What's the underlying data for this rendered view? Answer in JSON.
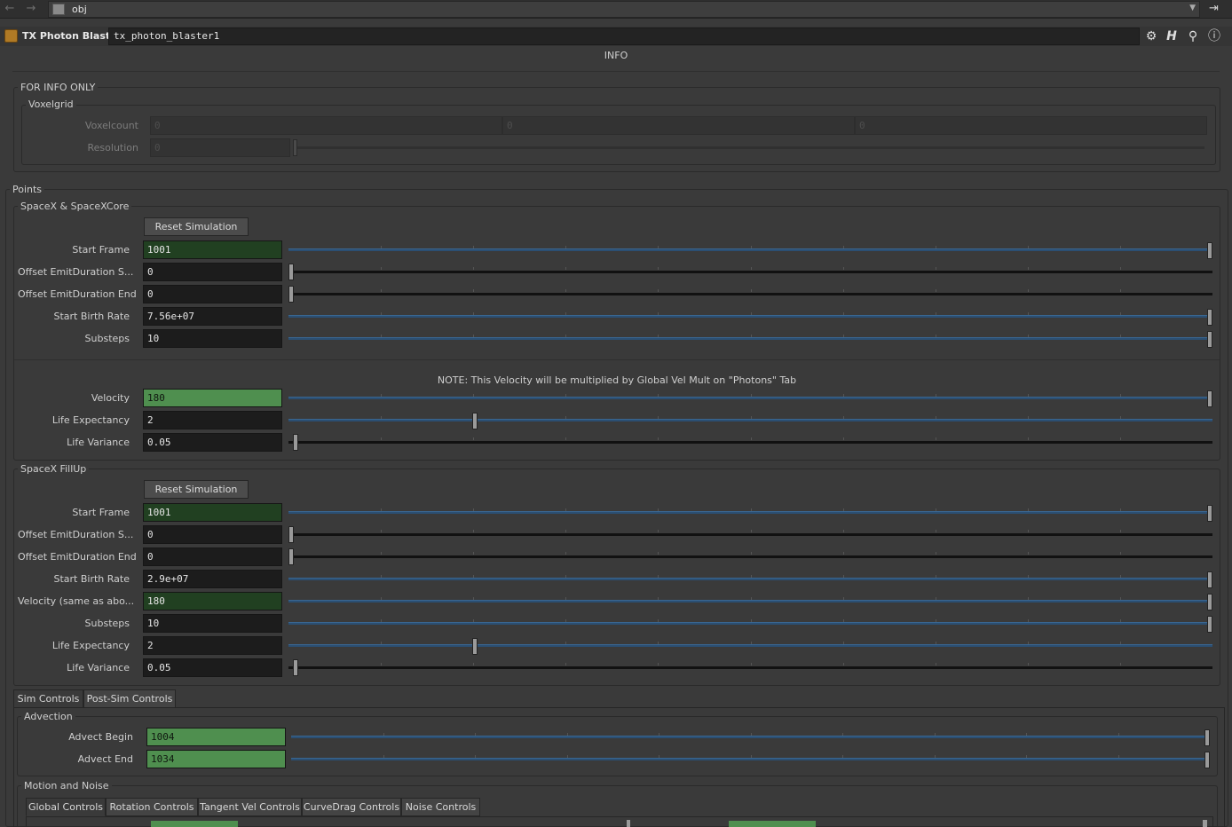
{
  "pathbar": {
    "back_icon": "arrow-left-icon",
    "forward_icon": "arrow-right-icon",
    "path": "obj",
    "pin_icon": "pin-icon"
  },
  "node": {
    "type": "TX Photon Blaster",
    "name": "tx_photon_blaster1",
    "icons": [
      "gear-icon",
      "help-h-icon",
      "search-icon",
      "info-icon"
    ]
  },
  "info": {
    "heading": "INFO",
    "for_info_only": "FOR INFO ONLY",
    "voxelgrid": {
      "title": "Voxelgrid",
      "voxelcount_label": "Voxelcount",
      "voxelcount": [
        "0",
        "0",
        "0"
      ],
      "resolution_label": "Resolution",
      "resolution": "0"
    }
  },
  "points": {
    "title": "Points",
    "spacex": {
      "title": "SpaceX & SpaceXCore",
      "reset_label": "Reset Simulation",
      "params": [
        {
          "label": "Start Frame",
          "value": "1001",
          "style": "green",
          "slider": "blue",
          "level": 1.0
        },
        {
          "label": "Offset EmitDuration S...",
          "value": "0",
          "style": "",
          "slider": "black",
          "level": 0.0
        },
        {
          "label": "Offset EmitDuration End",
          "value": "0",
          "style": "",
          "slider": "black",
          "level": 0.0
        },
        {
          "label": "Start Birth Rate",
          "value": "7.56e+07",
          "style": "",
          "slider": "blue",
          "level": 1.0
        },
        {
          "label": "Substeps",
          "value": "10",
          "style": "",
          "slider": "blue",
          "level": 1.0
        }
      ],
      "note": "NOTE: This Velocity will be multiplied by Global Vel Mult on \"Photons\" Tab",
      "params2": [
        {
          "label": "Velocity",
          "value": "180",
          "style": "bright",
          "slider": "blue",
          "level": 1.0
        },
        {
          "label": "Life Expectancy",
          "value": "2",
          "style": "",
          "slider": "blue",
          "level": 0.2
        },
        {
          "label": "Life Variance",
          "value": "0.05",
          "style": "",
          "slider": "black",
          "level": 0.005
        }
      ]
    },
    "fillup": {
      "title": "SpaceX FillUp",
      "reset_label": "Reset Simulation",
      "params": [
        {
          "label": "Start Frame",
          "value": "1001",
          "style": "green",
          "slider": "blue",
          "level": 1.0
        },
        {
          "label": "Offset EmitDuration S...",
          "value": "0",
          "style": "",
          "slider": "black",
          "level": 0.0
        },
        {
          "label": "Offset EmitDuration End",
          "value": "0",
          "style": "",
          "slider": "black",
          "level": 0.0
        },
        {
          "label": "Start Birth Rate",
          "value": "2.9e+07",
          "style": "",
          "slider": "blue",
          "level": 1.0
        },
        {
          "label": "Velocity (same as abo...",
          "value": "180",
          "style": "green",
          "slider": "blue",
          "level": 1.0
        },
        {
          "label": "Substeps",
          "value": "10",
          "style": "",
          "slider": "blue",
          "level": 1.0
        },
        {
          "label": "Life Expectancy",
          "value": "2",
          "style": "",
          "slider": "blue",
          "level": 0.2
        },
        {
          "label": "Life Variance",
          "value": "0.05",
          "style": "",
          "slider": "black",
          "level": 0.005
        }
      ]
    }
  },
  "sim_tabs": [
    "Sim Controls",
    "Post-Sim Controls"
  ],
  "advection": {
    "title": "Advection",
    "params": [
      {
        "label": "Advect Begin",
        "value": "1004",
        "style": "bright",
        "slider": "blue",
        "level": 1.0
      },
      {
        "label": "Advect End",
        "value": "1034",
        "style": "bright",
        "slider": "blue",
        "level": 1.0
      }
    ]
  },
  "motion": {
    "title": "Motion and Noise",
    "tabs": [
      "Global Controls",
      "Rotation Controls",
      "Tangent Vel Controls",
      "CurveDrag Controls",
      "Noise Controls"
    ]
  },
  "colors": {
    "accent_green": "#4f8f4f",
    "dark_green": "#214021",
    "slider_blue": "#2b4f73"
  }
}
